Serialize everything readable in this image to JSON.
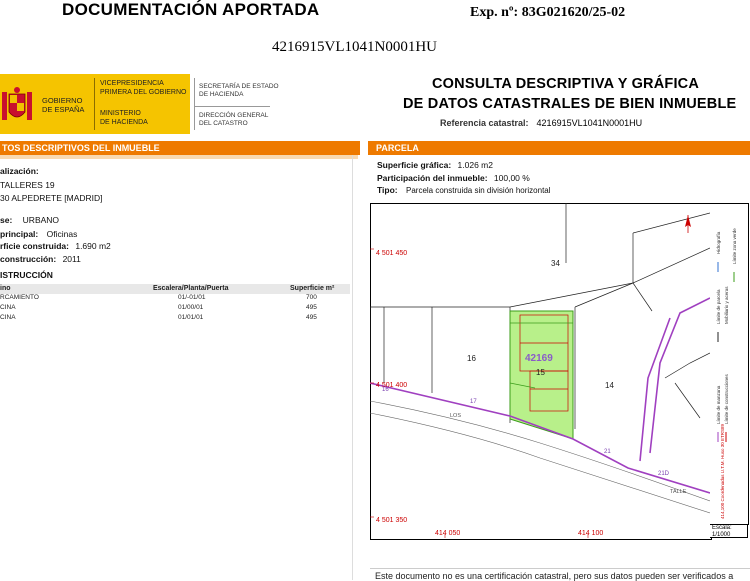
{
  "header": {
    "doc_label": "DOCUMENTACIÓN APORTADA",
    "exp": "Exp. nº: 83G021620/25-02",
    "ref_line": "4216915VL1041N0001HU"
  },
  "logo": {
    "gob_l1": "GOBIERNO",
    "gob_l2": "DE ESPAÑA",
    "vice_l1": "VICEPRESIDENCIA",
    "vice_l2": "PRIMERA DEL GOBIERNO",
    "min_l1": "MINISTERIO",
    "min_l2": "DE HACIENDA",
    "secr_l1": "SECRETARÍA DE ESTADO",
    "secr_l2": "DE HACIENDA",
    "dir_l1": "DIRECCIÓN GENERAL",
    "dir_l2": "DEL CATASTRO"
  },
  "title": {
    "line1": "CONSULTA DESCRIPTIVA Y GRÁFICA",
    "line2": "DE DATOS CATASTRALES DE BIEN INMUEBLE",
    "ref_label": "Referencia catastral:",
    "ref_value": "4216915VL1041N0001HU"
  },
  "left": {
    "bar": "TOS DESCRIPTIVOS DEL INMUEBLE",
    "loc_label": "alización:",
    "loc_l1": "TALLERES 19",
    "loc_l2": "30 ALPEDRETE [MADRID]",
    "clase_label": "se:",
    "clase_value": "URBANO",
    "uso_label": "principal:",
    "uso_value": "Oficinas",
    "sup_label": "rficie construida:",
    "sup_value": "1.690 m2",
    "anio_label": "construcción:",
    "anio_value": "2011",
    "cons_title": "ISTRUCCIÓN",
    "th_uso": "ino",
    "th_esc": "Escalera/Planta/Puerta",
    "th_sup": "Superficie m²",
    "rows": [
      {
        "uso": "RCAMIENTO",
        "esc": "01/-01/01",
        "sup": "700"
      },
      {
        "uso": "CINA",
        "esc": "01/00/01",
        "sup": "495"
      },
      {
        "uso": "CINA",
        "esc": "01/01/01",
        "sup": "495"
      }
    ]
  },
  "right": {
    "bar": "PARCELA",
    "sg_label": "Superficie gráfica:",
    "sg_value": "1.026 m2",
    "part_label": "Participación del inmueble:",
    "part_value": "100,00 %",
    "tipo_label": "Tipo:",
    "tipo_value": "Parcela construida sin división horizontal"
  },
  "map": {
    "coord_y1": "4 501 450",
    "coord_y2": "4 501 400",
    "coord_y3": "4 501 350",
    "coord_x1": "414 050",
    "coord_x2": "414 100",
    "parcel_34": "34",
    "parcel_16": "16",
    "parcel_15": "15",
    "parcel_14": "14",
    "block": "42169",
    "n16": "16",
    "n17": "17",
    "n21": "21",
    "n210": "21D",
    "road": "LOS",
    "road2": "TALLE",
    "legend_1": "Límite de manzana",
    "legend_2": "Límite de parcela",
    "legend_3": "Límite de construcciones",
    "legend_4": "Mobiliario y aceras",
    "legend_5": "Límite zona verde",
    "legend_6": "Hidrografía",
    "legend_coord": "414,100 Coordenadas U.T.M. Huso 30 ETRS89",
    "escala_label": "Escala:",
    "escala_value": "1/1000"
  },
  "footer": {
    "text": "Este documento no es una certificación catastral, pero sus datos pueden ser verificados a"
  }
}
